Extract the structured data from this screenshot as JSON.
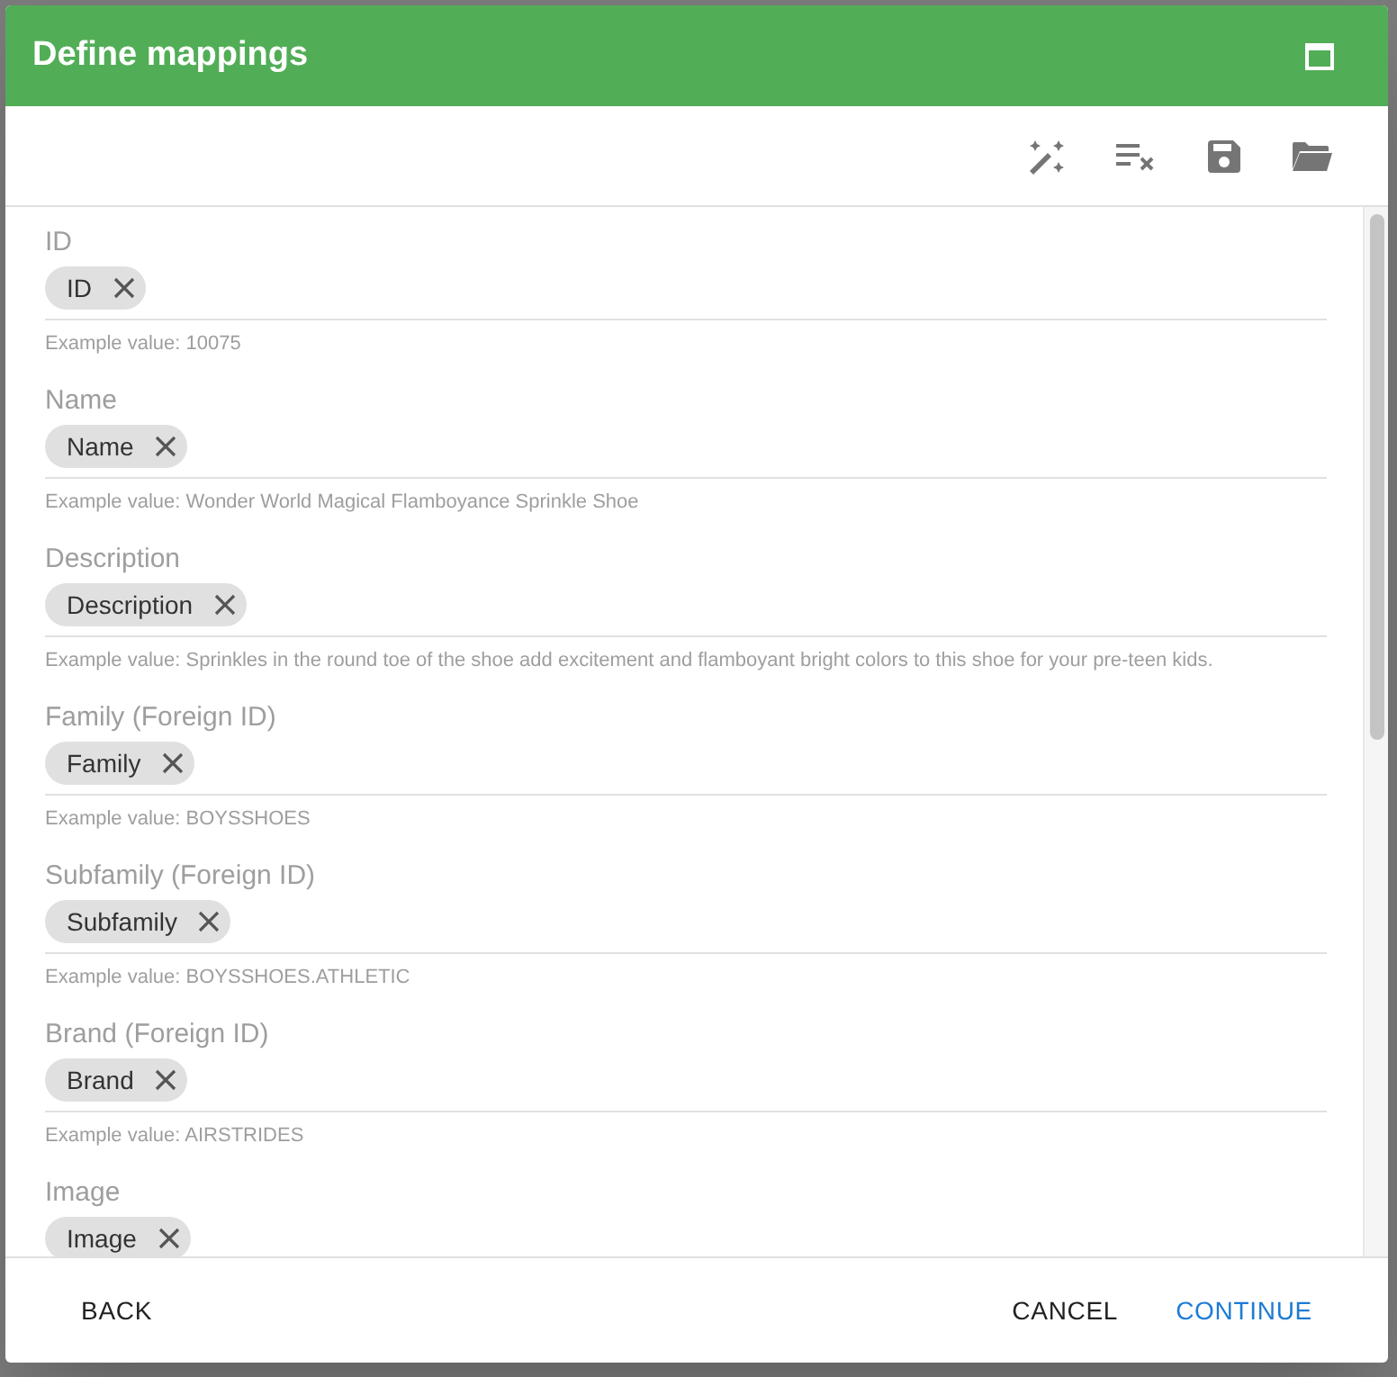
{
  "dialog": {
    "title": "Define mappings"
  },
  "fields": [
    {
      "label": "ID",
      "chip": "ID",
      "example": "Example value: 10075"
    },
    {
      "label": "Name",
      "chip": "Name",
      "example": "Example value: Wonder World Magical Flamboyance Sprinkle Shoe"
    },
    {
      "label": "Description",
      "chip": "Description",
      "example": "Example value: Sprinkles in the round toe of the shoe add excitement and flamboyant bright colors to this shoe for your pre-teen kids."
    },
    {
      "label": "Family (Foreign ID)",
      "chip": "Family",
      "example": "Example value: BOYSSHOES"
    },
    {
      "label": "Subfamily (Foreign ID)",
      "chip": "Subfamily",
      "example": "Example value: BOYSSHOES.ATHLETIC"
    },
    {
      "label": "Brand (Foreign ID)",
      "chip": "Brand",
      "example": "Example value: AIRSTRIDES"
    },
    {
      "label": "Image",
      "chip": "Image"
    }
  ],
  "buttons": [
    {
      "label": "BACK",
      "kind": "plain"
    },
    {
      "label": "CANCEL",
      "kind": "plain"
    },
    {
      "label": "CONTINUE",
      "kind": "primary"
    }
  ]
}
